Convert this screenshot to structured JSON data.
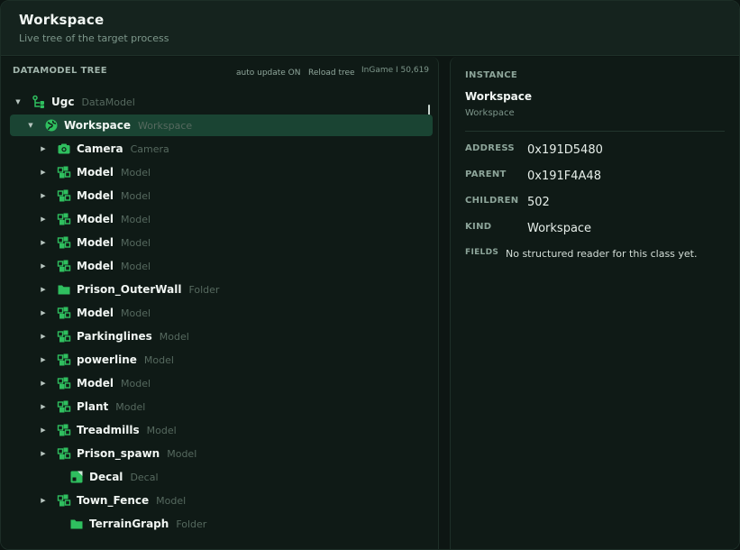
{
  "header": {
    "title": "Workspace",
    "subtitle": "Live tree of the target process"
  },
  "tree_panel": {
    "title": "DATAMODEL TREE",
    "auto_update": "auto update ON",
    "reload": "Reload tree",
    "status": "InGame I 50,619"
  },
  "tree": [
    {
      "name": "Ugc",
      "cls": "DataModel",
      "icon": "datamodel-icon",
      "depth": 0,
      "caret": "expanded"
    },
    {
      "name": "Workspace",
      "cls": "Workspace",
      "icon": "globe-icon",
      "depth": 1,
      "caret": "expanded",
      "selected": true
    },
    {
      "name": "Camera",
      "cls": "Camera",
      "icon": "camera-icon",
      "depth": 2,
      "caret": "collapsed"
    },
    {
      "name": "Model",
      "cls": "Model",
      "icon": "model-icon",
      "depth": 2,
      "caret": "collapsed"
    },
    {
      "name": "Model",
      "cls": "Model",
      "icon": "model-icon",
      "depth": 2,
      "caret": "collapsed"
    },
    {
      "name": "Model",
      "cls": "Model",
      "icon": "model-icon",
      "depth": 2,
      "caret": "collapsed"
    },
    {
      "name": "Model",
      "cls": "Model",
      "icon": "model-icon",
      "depth": 2,
      "caret": "collapsed"
    },
    {
      "name": "Model",
      "cls": "Model",
      "icon": "model-icon",
      "depth": 2,
      "caret": "collapsed"
    },
    {
      "name": "Prison_OuterWall",
      "cls": "Folder",
      "icon": "folder-icon",
      "depth": 2,
      "caret": "collapsed"
    },
    {
      "name": "Model",
      "cls": "Model",
      "icon": "model-icon",
      "depth": 2,
      "caret": "collapsed"
    },
    {
      "name": "Parkinglines",
      "cls": "Model",
      "icon": "model-icon",
      "depth": 2,
      "caret": "collapsed"
    },
    {
      "name": "powerline",
      "cls": "Model",
      "icon": "model-icon",
      "depth": 2,
      "caret": "collapsed"
    },
    {
      "name": "Model",
      "cls": "Model",
      "icon": "model-icon",
      "depth": 2,
      "caret": "collapsed"
    },
    {
      "name": "Plant",
      "cls": "Model",
      "icon": "model-icon",
      "depth": 2,
      "caret": "collapsed"
    },
    {
      "name": "Treadmills",
      "cls": "Model",
      "icon": "model-icon",
      "depth": 2,
      "caret": "collapsed"
    },
    {
      "name": "Prison_spawn",
      "cls": "Model",
      "icon": "model-icon",
      "depth": 2,
      "caret": "collapsed"
    },
    {
      "name": "Decal",
      "cls": "Decal",
      "icon": "decal-icon",
      "depth": 2,
      "caret": "none"
    },
    {
      "name": "Town_Fence",
      "cls": "Model",
      "icon": "model-icon",
      "depth": 2,
      "caret": "collapsed"
    },
    {
      "name": "TerrainGraph",
      "cls": "Folder",
      "icon": "folder-icon",
      "depth": 2,
      "caret": "none"
    }
  ],
  "instance": {
    "label": "INSTANCE",
    "name": "Workspace",
    "cls": "Workspace",
    "props": [
      {
        "key": "ADDRESS",
        "value": "0x191D5480"
      },
      {
        "key": "PARENT",
        "value": "0x191F4A48"
      },
      {
        "key": "CHILDREN",
        "value": "502"
      },
      {
        "key": "KIND",
        "value": "Workspace"
      }
    ],
    "fields_key": "FIELDS",
    "fields_value": "No structured reader for this class yet."
  },
  "colors": {
    "accent": "#2fbf5f",
    "selected_row": "#1a4433"
  }
}
